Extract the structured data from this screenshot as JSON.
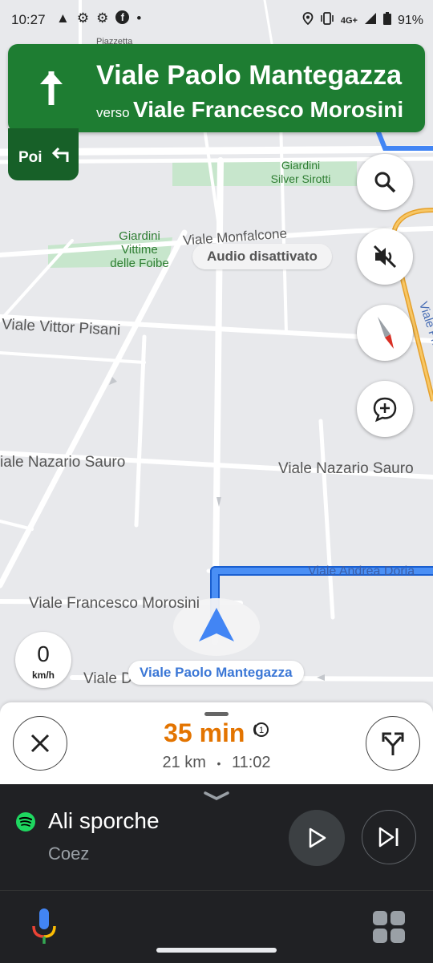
{
  "status_bar": {
    "time": "10:27",
    "network": "4G+",
    "battery": "91%"
  },
  "navigation": {
    "street": "Viale Paolo Mantegazza",
    "toward_prefix": "verso",
    "toward_street": "Viale Francesco Morosini",
    "then_label": "Poi",
    "maneuver_icon": "arrow-straight-icon",
    "then_icon": "turn-left-icon"
  },
  "map": {
    "labels": {
      "piazzetta": "Piazzetta",
      "giardini_sirotti": "Giardini\nSilver Sirotti",
      "giardini_foibe": "Giardini\nVittime\ndelle Foibe",
      "monfalcone": "Viale Monfalcone",
      "vittor_pisani": "Viale Vittor Pisani",
      "sauro_left": "iale Nazario Sauro",
      "sauro_right": "Viale Nazario Sauro",
      "andrea_doria": "Viale Andrea Doria",
      "morosini": "Viale Francesco Morosini",
      "principe": "Viale Principe Amedeo",
      "dandolo": "Viale Dandolo"
    },
    "audio_chip": "Audio disattivato",
    "current_street": "Viale Paolo Mantegazza",
    "speed_value": "0",
    "speed_unit": "km/h"
  },
  "trip": {
    "eta": "35 min",
    "distance": "21 km",
    "separator": "•",
    "arrival": "11:02"
  },
  "media": {
    "title": "Ali sporche",
    "artist": "Coez",
    "app_icon": "spotify-icon"
  },
  "colors": {
    "nav_green": "#1e7d32",
    "then_green": "#176028",
    "route_blue": "#4285f4",
    "eta_orange": "#e37400"
  }
}
